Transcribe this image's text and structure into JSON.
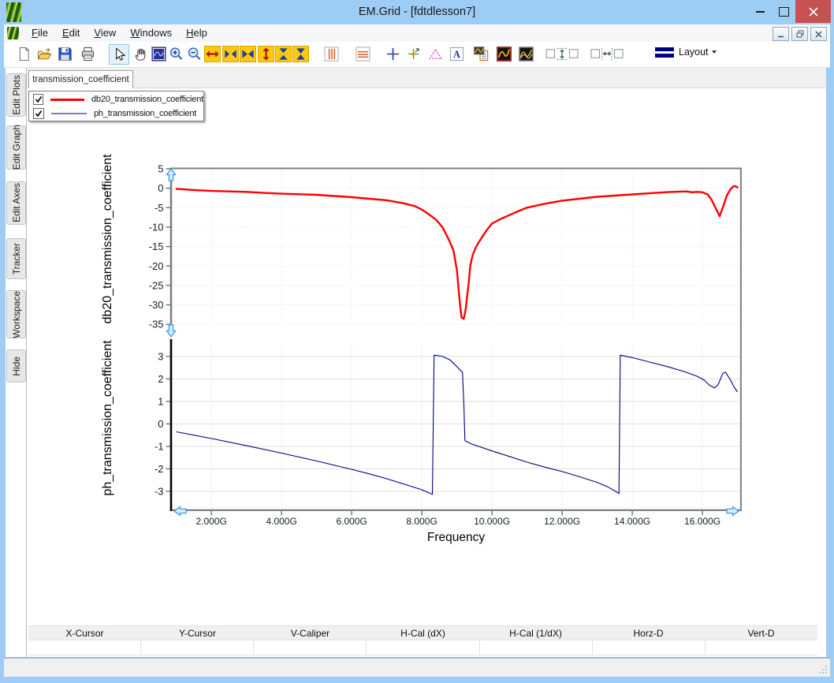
{
  "window": {
    "title": "EM.Grid - [fdtdlesson7]",
    "caption_buttons": [
      "minimize",
      "maximize",
      "close"
    ]
  },
  "menu": {
    "items": [
      "File",
      "Edit",
      "View",
      "Windows",
      "Help"
    ],
    "mdi_buttons": [
      "minimize",
      "restore",
      "close"
    ]
  },
  "toolbar": {
    "items": [
      "new-file",
      "open-file",
      "save",
      "print",
      "select-cursor",
      "pan-hand",
      "plot-navigator",
      "zoom-in",
      "zoom-out",
      "full-extent-horizontal",
      "shrink-horizontal",
      "expand-horizontal",
      "full-extent-vertical",
      "shrink-vertical",
      "expand-vertical",
      "vertical-gridlines",
      "horizontal-gridlines",
      "add-cursor",
      "add-marker",
      "add-triangle-marker",
      "add-text",
      "copy-plot-to-report",
      "plot-style-dark",
      "plot-style-multi",
      "equal-vertical-spacing",
      "equal-horizontal-spacing"
    ],
    "layout_label": "Layout"
  },
  "sidebar": {
    "tabs": [
      "Edit Plots",
      "Edit Graph",
      "Edit Axes",
      "Tracker",
      "Workspace",
      "Hide"
    ]
  },
  "document_tab": "transmission_coefficient",
  "legend": {
    "entries": [
      {
        "label": "db20_transmission_coefficient",
        "color": "#ff0000",
        "checked": true
      },
      {
        "label": "ph_transmission_coefficient",
        "color": "#7f7fbf",
        "checked": true
      }
    ]
  },
  "cursor_table": {
    "headers": [
      "X-Cursor",
      "Y-Cursor",
      "V-Caliper",
      "H-Cal (dX)",
      "H-Cal (1/dX)",
      "Horz-D",
      "Vert-D"
    ],
    "values": [
      "",
      "",
      "",
      "",
      "",
      "",
      ""
    ]
  },
  "chart_data": {
    "type": "line",
    "xlabel": "Frequency",
    "x_ticks": [
      2,
      4,
      6,
      8,
      10,
      12,
      14,
      16
    ],
    "x_tick_labels": [
      "2.000G",
      "4.000G",
      "6.000G",
      "8.000G",
      "10.000G",
      "12.000G",
      "14.000G",
      "16.000G"
    ],
    "x_range": [
      0.85,
      17.1
    ],
    "subplots": [
      {
        "ylabel": "db20_transmission_coefficient",
        "y_ticks": [
          5,
          0,
          -5,
          -10,
          -15,
          -20,
          -25,
          -30,
          -35
        ],
        "y_range": [
          5,
          -35
        ],
        "series": {
          "name": "db20_transmission_coefficient",
          "color": "#ff0000",
          "points": [
            [
              1,
              -0.15
            ],
            [
              1.5,
              -0.45
            ],
            [
              2,
              -0.7
            ],
            [
              2.5,
              -0.82
            ],
            [
              3,
              -0.95
            ],
            [
              3.5,
              -1.2
            ],
            [
              4,
              -1.4
            ],
            [
              4.5,
              -1.55
            ],
            [
              5,
              -1.7
            ],
            [
              5.5,
              -2.0
            ],
            [
              6,
              -2.3
            ],
            [
              6.5,
              -2.7
            ],
            [
              7,
              -3.1
            ],
            [
              7.5,
              -3.9
            ],
            [
              7.8,
              -4.6
            ],
            [
              8,
              -5.5
            ],
            [
              8.2,
              -6.7
            ],
            [
              8.42,
              -8.2
            ],
            [
              8.6,
              -10.2
            ],
            [
              8.78,
              -13.4
            ],
            [
              8.9,
              -16
            ],
            [
              9.0,
              -21
            ],
            [
              9.05,
              -26
            ],
            [
              9.09,
              -30
            ],
            [
              9.13,
              -33.2
            ],
            [
              9.19,
              -33.6
            ],
            [
              9.23,
              -32.2
            ],
            [
              9.26,
              -30.5
            ],
            [
              9.3,
              -27
            ],
            [
              9.33,
              -25
            ],
            [
              9.38,
              -20
            ],
            [
              9.45,
              -17.2
            ],
            [
              9.55,
              -15
            ],
            [
              9.7,
              -12.8
            ],
            [
              9.85,
              -10.8
            ],
            [
              10,
              -9.1
            ],
            [
              10.25,
              -7.9
            ],
            [
              10.5,
              -6.9
            ],
            [
              10.75,
              -5.9
            ],
            [
              11,
              -5.0
            ],
            [
              11.5,
              -4.0
            ],
            [
              12,
              -3.2
            ],
            [
              12.5,
              -2.7
            ],
            [
              13,
              -2.2
            ],
            [
              13.5,
              -1.9
            ],
            [
              14,
              -1.6
            ],
            [
              14.5,
              -1.3
            ],
            [
              15,
              -1.0
            ],
            [
              15.3,
              -0.9
            ],
            [
              15.55,
              -0.82
            ],
            [
              15.7,
              -1.05
            ],
            [
              15.85,
              -0.95
            ],
            [
              16,
              -1.05
            ],
            [
              16.15,
              -1.6
            ],
            [
              16.25,
              -2.8
            ],
            [
              16.35,
              -4.6
            ],
            [
              16.49,
              -7.2
            ],
            [
              16.6,
              -4.5
            ],
            [
              16.7,
              -1.8
            ],
            [
              16.8,
              -0.3
            ],
            [
              16.88,
              0.45
            ],
            [
              16.94,
              0.55
            ],
            [
              17,
              0.2
            ]
          ]
        }
      },
      {
        "ylabel": "ph_transmission_coefficient",
        "y_ticks": [
          3,
          2,
          1,
          0,
          -1,
          -2,
          -3
        ],
        "y_range": [
          3.9,
          -3.95
        ],
        "series": {
          "name": "ph_transmission_coefficient",
          "color": "#000080",
          "points": [
            [
              1,
              -0.35
            ],
            [
              2,
              -0.65
            ],
            [
              3,
              -0.97
            ],
            [
              4,
              -1.3
            ],
            [
              5,
              -1.65
            ],
            [
              6,
              -2.02
            ],
            [
              6.5,
              -2.22
            ],
            [
              7,
              -2.44
            ],
            [
              7.5,
              -2.68
            ],
            [
              8,
              -2.93
            ],
            [
              8.3,
              -3.13
            ],
            [
              8.35,
              3.06
            ],
            [
              8.6,
              3.0
            ],
            [
              8.8,
              2.85
            ],
            [
              9.0,
              2.55
            ],
            [
              9.1,
              2.38
            ],
            [
              9.16,
              2.3
            ],
            [
              9.2,
              0.8
            ],
            [
              9.23,
              -0.75
            ],
            [
              9.4,
              -0.88
            ],
            [
              10,
              -1.2
            ],
            [
              10.5,
              -1.45
            ],
            [
              11,
              -1.7
            ],
            [
              11.5,
              -1.92
            ],
            [
              12,
              -2.12
            ],
            [
              12.5,
              -2.35
            ],
            [
              13,
              -2.6
            ],
            [
              13.3,
              -2.8
            ],
            [
              13.55,
              -3.02
            ],
            [
              13.62,
              -3.1
            ],
            [
              13.66,
              3.06
            ],
            [
              14,
              2.95
            ],
            [
              14.5,
              2.75
            ],
            [
              15,
              2.55
            ],
            [
              15.5,
              2.32
            ],
            [
              15.85,
              2.12
            ],
            [
              16.05,
              1.95
            ],
            [
              16.2,
              1.72
            ],
            [
              16.35,
              1.6
            ],
            [
              16.45,
              1.75
            ],
            [
              16.58,
              2.25
            ],
            [
              16.66,
              2.3
            ],
            [
              16.8,
              1.95
            ],
            [
              16.9,
              1.65
            ],
            [
              17,
              1.42
            ]
          ]
        }
      }
    ]
  }
}
